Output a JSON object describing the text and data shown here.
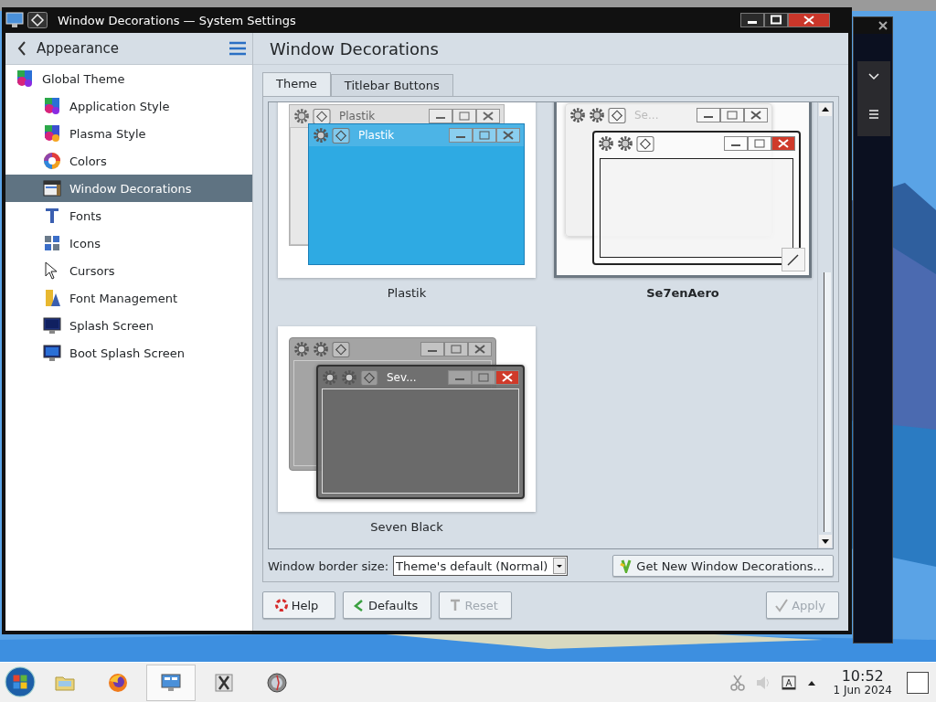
{
  "window": {
    "title": "Window Decorations — System Settings"
  },
  "sidebar": {
    "back_label": "Appearance",
    "items": [
      {
        "label": "Global Theme",
        "selected": false,
        "children": [
          {
            "label": "Application Style",
            "selected": false
          },
          {
            "label": "Plasma Style",
            "selected": false
          },
          {
            "label": "Colors",
            "selected": false
          },
          {
            "label": "Window Decorations",
            "selected": true
          },
          {
            "label": "Fonts",
            "selected": false
          },
          {
            "label": "Icons",
            "selected": false
          },
          {
            "label": "Cursors",
            "selected": false
          },
          {
            "label": "Font Management",
            "selected": false
          },
          {
            "label": "Splash Screen",
            "selected": false
          },
          {
            "label": "Boot Splash Screen",
            "selected": false
          }
        ]
      }
    ]
  },
  "page_title": "Window Decorations",
  "tabs": [
    {
      "label": "Theme",
      "selected": true
    },
    {
      "label": "Titlebar Buttons",
      "selected": false
    }
  ],
  "themes": [
    {
      "name": "Plastik",
      "selected": false,
      "kind": "plastik",
      "back_title": "Plastik",
      "front_title": "Plastik"
    },
    {
      "name": "Se7enAero",
      "selected": true,
      "kind": "aero",
      "back_title": "Se..."
    },
    {
      "name": "Seven Black",
      "selected": false,
      "kind": "black",
      "front_title": "Sev..."
    }
  ],
  "border_size": {
    "label": "Window border size:",
    "value": "Theme's default (Normal)"
  },
  "get_new_label": "Get New Window Decorations...",
  "buttons": [
    {
      "label": "Help",
      "disabled": false
    },
    {
      "label": "Defaults",
      "disabled": false
    },
    {
      "label": "Reset",
      "disabled": true
    },
    {
      "label": "Apply",
      "disabled": true
    }
  ],
  "taskbar": {
    "apps": [
      {
        "selected": false
      },
      {
        "selected": false
      },
      {
        "selected": true
      },
      {
        "selected": false
      },
      {
        "selected": false
      }
    ],
    "clock": {
      "time": "10:52",
      "date": "1 Jun 2024"
    }
  }
}
